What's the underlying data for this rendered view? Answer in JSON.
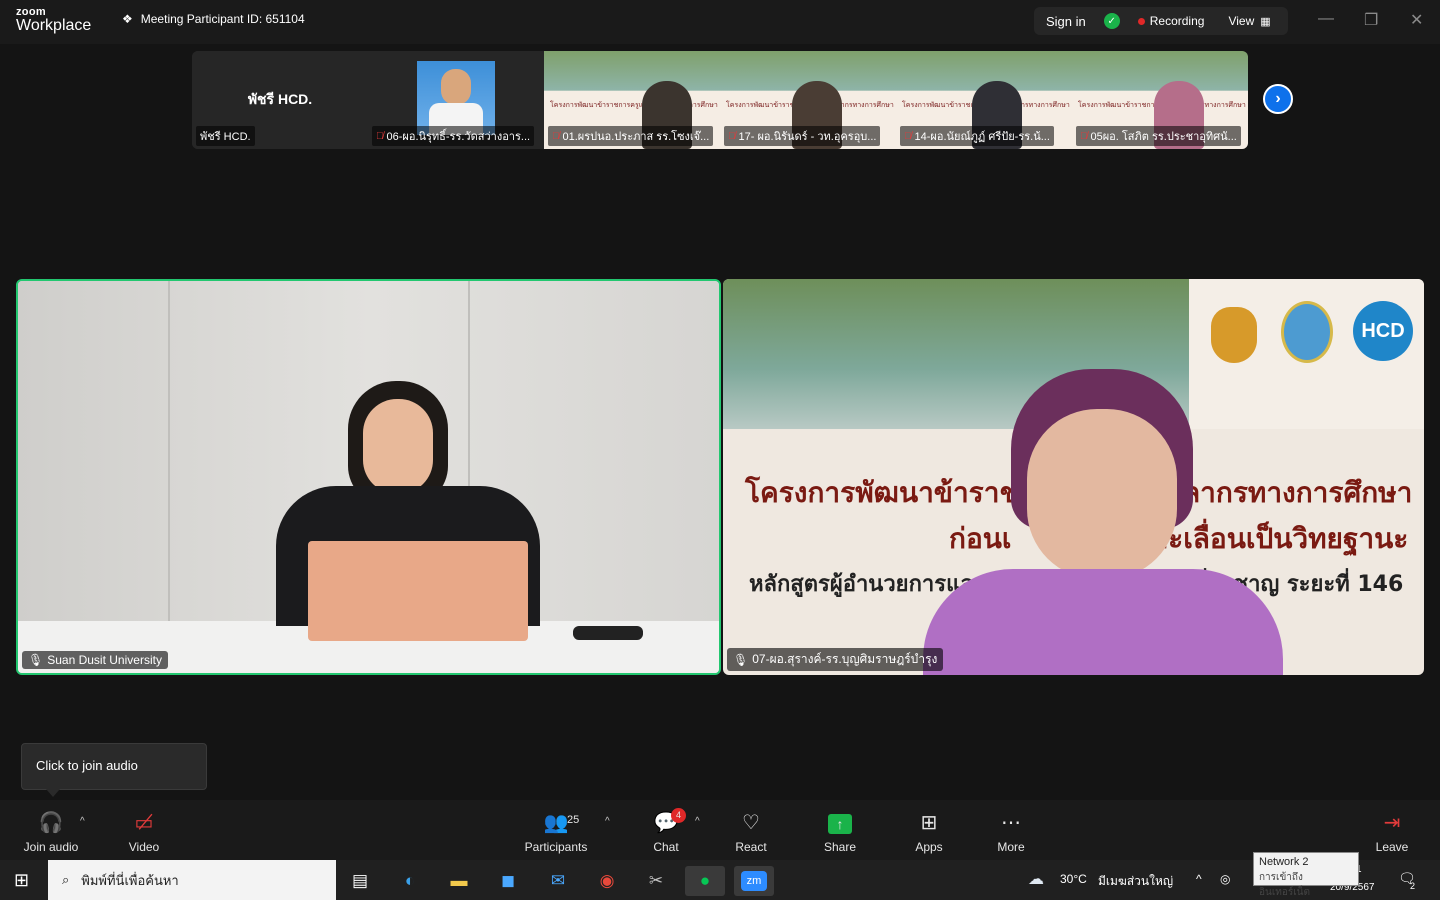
{
  "titlebar": {
    "logo_top": "zoom",
    "logo_bottom": "Workplace",
    "meeting_id": "Meeting Participant ID: 651104",
    "signin": "Sign in",
    "recording": "Recording",
    "view": "View"
  },
  "thumbnails": [
    {
      "name": "พัชรี HCD.",
      "big": "พัชรี HCD."
    },
    {
      "name": "06-ผอ.นิรุทธิ์-รร.วัดสว่างอาร..."
    },
    {
      "name": "01.ผรปนอ.ประภาส รร.โซงเจ๊..."
    },
    {
      "name": "17- ผอ.นิรันดร์ - วท.อุครอุบ..."
    },
    {
      "name": "14-ผอ.นัยณ์ภูฏ์ ศรีปัย-รร.น้..."
    },
    {
      "name": "05ผอ. โสภิต  รร.ประชาอุทิศนั..."
    }
  ],
  "slide_small": "โครงการพัฒนาข้าราชการครูและบุคลากรทางการศึกษา",
  "main_tiles": [
    {
      "name": "Suan Dusit University"
    },
    {
      "name": "07-ผอ.สุรางค์-รร.บุญศิมราษฎร์บำรุง"
    }
  ],
  "slide": {
    "line1": "โครงการพัฒนาข้าราช",
    "line1b": "ลากรทางการศึกษา",
    "line2a": "ก่อนเ",
    "line2b": "ละเลื่อนเป็นวิทยฐานะ",
    "line3a": "หลักสูตรผู้อำนวยการและ",
    "line3b": "ชี่ยาชาญ ระยะที่ 146",
    "logo3": "HCD"
  },
  "tooltip": "Click to join audio",
  "toolbar": {
    "join_audio": "Join audio",
    "video": "Video",
    "participants": "Participants",
    "participants_count": "25",
    "chat": "Chat",
    "chat_badge": "4",
    "react": "React",
    "share": "Share",
    "apps": "Apps",
    "more": "More",
    "leave": "Leave"
  },
  "taskbar": {
    "search_placeholder": "พิมพ์ที่นี่เพื่อค้นหา",
    "weather": "30°C",
    "weather_desc": "มีเมฆส่วนใหญ่",
    "date": "20/9/2567",
    "time_partial": "1",
    "notif_count": "2",
    "net_title": "Network 2",
    "net_sub": "การเข้าถึงอินเทอร์เน็ต"
  },
  "colors": {
    "accent_blue": "#0e71eb",
    "active_speaker": "#23c770",
    "recording_red": "#e02828",
    "share_green": "#1ab34a"
  }
}
